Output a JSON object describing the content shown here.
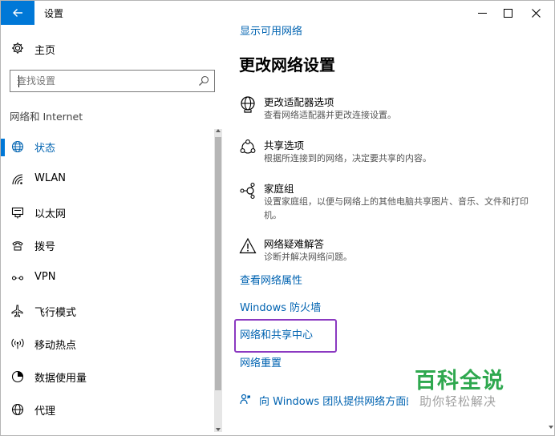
{
  "window": {
    "title": "设置",
    "controls": [
      "minimize",
      "maximize",
      "close"
    ]
  },
  "nav": {
    "home_label": "主页",
    "search_placeholder": "查找设置",
    "section_label": "网络和 Internet",
    "items": [
      {
        "label": "状态",
        "icon": "globe-icon",
        "active": true
      },
      {
        "label": "WLAN",
        "icon": "wifi-icon",
        "active": false
      },
      {
        "label": "以太网",
        "icon": "ethernet-icon",
        "active": false
      },
      {
        "label": "拨号",
        "icon": "dialup-icon",
        "active": false
      },
      {
        "label": "VPN",
        "icon": "vpn-icon",
        "active": false
      },
      {
        "label": "飞行模式",
        "icon": "airplane-icon",
        "active": false
      },
      {
        "label": "移动热点",
        "icon": "hotspot-icon",
        "active": false
      },
      {
        "label": "数据使用量",
        "icon": "data-usage-icon",
        "active": false
      },
      {
        "label": "代理",
        "icon": "proxy-globe-icon",
        "active": false
      }
    ]
  },
  "main": {
    "top_link": "显示可用网络",
    "heading": "更改网络设置",
    "settings": [
      {
        "title": "更改适配器选项",
        "desc": "查看网络适配器并更改连接设置。",
        "icon": "adapter-globe-icon"
      },
      {
        "title": "共享选项",
        "desc": "根据所连接到的网络，决定要共享的内容。",
        "icon": "sharing-icon"
      },
      {
        "title": "家庭组",
        "desc": "设置家庭组，以便与网络上的其他电脑共享图片、音乐、文件和打印机。",
        "icon": "homegroup-icon"
      },
      {
        "title": "网络疑难解答",
        "desc": "诊断并解决网络问题。",
        "icon": "warning-icon"
      }
    ],
    "links": {
      "network_properties": "查看网络属性",
      "firewall": "Windows 防火墙",
      "sharing_center": "网络和共享中心",
      "reset": "网络重置"
    },
    "feedback": "向 Windows 团队提供网络方面的反馈"
  },
  "watermark": {
    "title": "百科全说",
    "subtitle": "助你轻松解决"
  },
  "colors": {
    "accent": "#0078d7",
    "link": "#0063b1",
    "highlight_border": "#8b39c1",
    "watermark_green": "#2fa84f"
  }
}
